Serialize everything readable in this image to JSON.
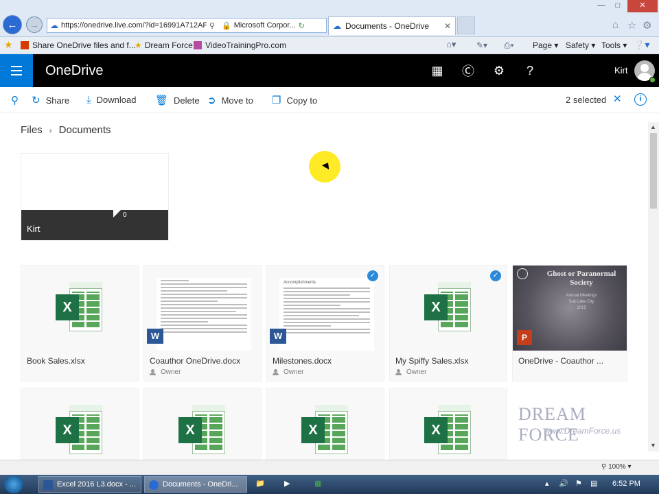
{
  "browser": {
    "address_url": "https://onedrive.live.com/?id=16991A712AF",
    "cert_label": "Microsoft Corpor...",
    "tab_title": "Documents - OneDrive",
    "favorites": [
      {
        "label": "Share OneDrive files and f..."
      },
      {
        "label": "Dream Force"
      },
      {
        "label": "VideoTrainingPro.com"
      }
    ],
    "commands": {
      "page": "Page",
      "safety": "Safety",
      "tools": "Tools"
    },
    "zoom": "100%"
  },
  "onedrive": {
    "brand": "OneDrive",
    "user_name": "Kirt",
    "toolbar": {
      "share": "Share",
      "download": "Download",
      "delete": "Delete",
      "move_to": "Move to",
      "copy_to": "Copy to",
      "selected_count": "2 selected"
    },
    "breadcrumb": {
      "root": "Files",
      "current": "Documents"
    },
    "folder": {
      "name": "Kirt",
      "count": "0"
    },
    "files": [
      {
        "name": "Book Sales.xlsx",
        "type": "excel",
        "owner": "",
        "selected": false
      },
      {
        "name": "Coauthor OneDrive.docx",
        "type": "word",
        "owner": "Owner",
        "selected": false
      },
      {
        "name": "Milestones.docx",
        "type": "word",
        "owner": "Owner",
        "selected": true
      },
      {
        "name": "My Spiffy Sales.xlsx",
        "type": "excel",
        "owner": "Owner",
        "selected": true
      },
      {
        "name": "OneDrive - Coauthor ...",
        "type": "powerpoint",
        "owner": "",
        "selected": false
      }
    ],
    "slide": {
      "title": "Ghost or Paranormal Society",
      "sub1": "Annual Meetings",
      "sub2": "Salt Lake City",
      "sub3": "2015"
    },
    "doc_heading": "Accomplishments"
  },
  "watermark": {
    "line1": "DREAM FORCE",
    "line2": "www.DreamForce.us"
  },
  "taskbar": {
    "items": [
      {
        "label": "Excel 2016 L3.docx - ..."
      },
      {
        "label": "Documents - OneDri..."
      }
    ],
    "clock": "6:52 PM"
  },
  "colors": {
    "accent": "#0078d7",
    "header_bg": "#000000",
    "excel": "#1e7145",
    "word": "#2b5797",
    "powerpoint": "#c43e1c"
  }
}
